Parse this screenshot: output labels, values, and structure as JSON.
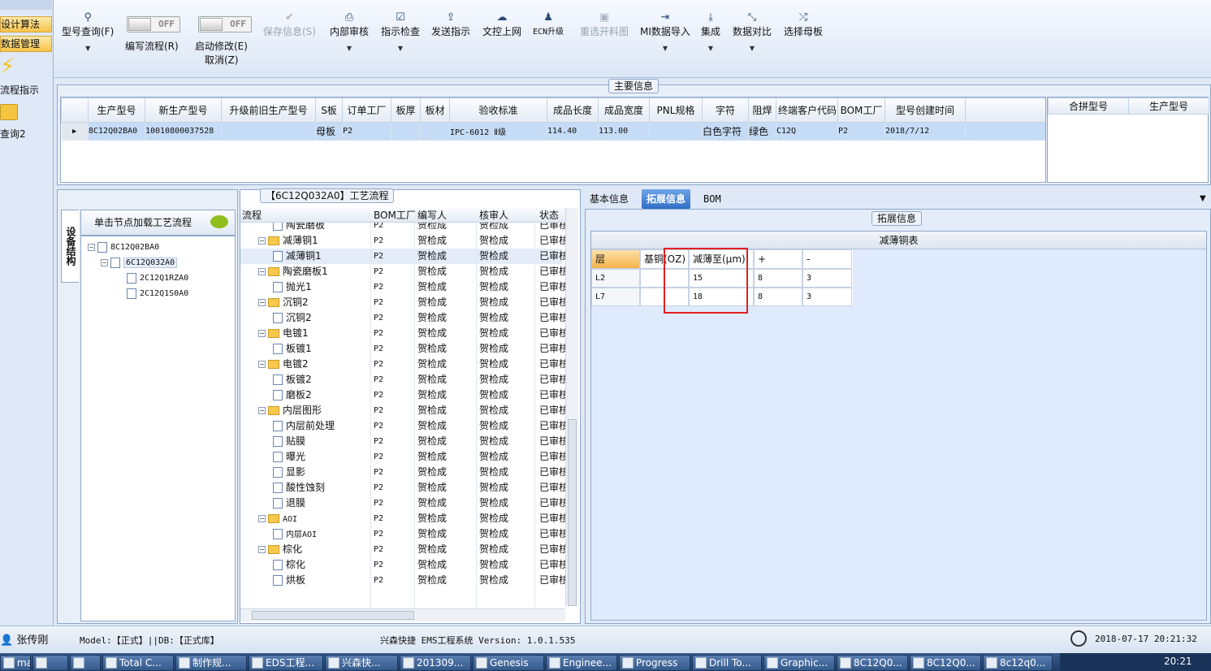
{
  "leftnav": {
    "items": [
      "设计算法",
      "数据管理"
    ],
    "big1": "流程指示",
    "big2": "查询2"
  },
  "toolbar": {
    "buttons": [
      {
        "label": "型号查询(F)",
        "icon": "search-icon"
      },
      {
        "label": "保存信息(S)",
        "icon": "check-icon",
        "disabled": true
      },
      {
        "label": "内部审核",
        "icon": "printer-icon"
      },
      {
        "label": "指示检查",
        "icon": "check-box-icon"
      },
      {
        "label": "发送指示",
        "icon": "upload-icon"
      },
      {
        "label": "文控上网",
        "icon": "cloud-icon"
      },
      {
        "label": "ECN升级",
        "icon": "users-icon"
      },
      {
        "label": "重选开料图",
        "icon": "image-icon",
        "disabled": true
      },
      {
        "label": "MI数据导入",
        "icon": "import-icon"
      },
      {
        "label": "集成",
        "icon": "download-icon"
      },
      {
        "label": "数据对比",
        "icon": "compare-icon"
      },
      {
        "label": "选择母板",
        "icon": "shuffle-icon"
      }
    ],
    "toggle1": {
      "state": "OFF",
      "label": "编写流程(R)"
    },
    "toggle2": {
      "state": "OFF",
      "label": "启动修改(E)",
      "sub": "取消(Z)"
    }
  },
  "main": {
    "title": "主要信息",
    "columns": [
      "生产型号",
      "新生产型号",
      "升级前旧生产型号",
      "S板",
      "订单工厂",
      "板厚",
      "板材",
      "验收标准",
      "成品长度",
      "成品宽度",
      "PNL规格",
      "字符",
      "阻焊",
      "终端客户代码",
      "BOM工厂",
      "型号创建时间"
    ],
    "row": [
      "8C12Q02BA0",
      "10010800037528",
      "",
      "母板",
      "P2",
      "",
      "",
      "IPC-6012 Ⅱ级",
      "114.40",
      "113.00",
      "",
      "白色字符",
      "绿色",
      "C12Q",
      "P2",
      "2018/7/12"
    ],
    "side_columns": [
      "合拼型号",
      "生产型号"
    ]
  },
  "tree": {
    "sidetab": "设备结构",
    "hint": "单击节点加载工艺流程",
    "nodes": [
      "8C12Q02BA0",
      "6C12Q032A0",
      "2C12Q1RZA0",
      "2C12Q1S0A0"
    ]
  },
  "process": {
    "title": "【6C12Q032A0】工艺流程",
    "columns": [
      "流程",
      "BOM工厂",
      "编写人",
      "核审人",
      "状态"
    ],
    "rows": [
      {
        "name": "陶瓷磨板",
        "level": 2,
        "f": "P2",
        "w": "贺检成",
        "c": "贺检成",
        "s": "已审核"
      },
      {
        "name": "减薄铜1",
        "level": 1,
        "f": "P2",
        "w": "贺检成",
        "c": "贺检成",
        "s": "已审核"
      },
      {
        "name": "减薄铜1",
        "level": 2,
        "f": "P2",
        "w": "贺检成",
        "c": "贺检成",
        "s": "已审核",
        "sel": true
      },
      {
        "name": "陶瓷磨板1",
        "level": 1,
        "f": "P2",
        "w": "贺检成",
        "c": "贺检成",
        "s": "已审核"
      },
      {
        "name": "抛光1",
        "level": 2,
        "f": "P2",
        "w": "贺检成",
        "c": "贺检成",
        "s": "已审核"
      },
      {
        "name": "沉铜2",
        "level": 1,
        "f": "P2",
        "w": "贺检成",
        "c": "贺检成",
        "s": "已审核"
      },
      {
        "name": "沉铜2",
        "level": 2,
        "f": "P2",
        "w": "贺检成",
        "c": "贺检成",
        "s": "已审核"
      },
      {
        "name": "电镀1",
        "level": 1,
        "f": "P2",
        "w": "贺检成",
        "c": "贺检成",
        "s": "已审核"
      },
      {
        "name": "板镀1",
        "level": 2,
        "f": "P2",
        "w": "贺检成",
        "c": "贺检成",
        "s": "已审核"
      },
      {
        "name": "电镀2",
        "level": 1,
        "f": "P2",
        "w": "贺检成",
        "c": "贺检成",
        "s": "已审核"
      },
      {
        "name": "板镀2",
        "level": 2,
        "f": "P2",
        "w": "贺检成",
        "c": "贺检成",
        "s": "已审核"
      },
      {
        "name": "磨板2",
        "level": 2,
        "f": "P2",
        "w": "贺检成",
        "c": "贺检成",
        "s": "已审核"
      },
      {
        "name": "内层图形",
        "level": 1,
        "f": "P2",
        "w": "贺检成",
        "c": "贺检成",
        "s": "已审核"
      },
      {
        "name": "内层前处理",
        "level": 2,
        "f": "P2",
        "w": "贺检成",
        "c": "贺检成",
        "s": "已审核"
      },
      {
        "name": "贴膜",
        "level": 2,
        "f": "P2",
        "w": "贺检成",
        "c": "贺检成",
        "s": "已审核"
      },
      {
        "name": "曝光",
        "level": 2,
        "f": "P2",
        "w": "贺检成",
        "c": "贺检成",
        "s": "已审核"
      },
      {
        "name": "显影",
        "level": 2,
        "f": "P2",
        "w": "贺检成",
        "c": "贺检成",
        "s": "已审核"
      },
      {
        "name": "酸性蚀刻",
        "level": 2,
        "f": "P2",
        "w": "贺检成",
        "c": "贺检成",
        "s": "已审核"
      },
      {
        "name": "退膜",
        "level": 2,
        "f": "P2",
        "w": "贺检成",
        "c": "贺检成",
        "s": "已审核"
      },
      {
        "name": "AOI",
        "level": 1,
        "f": "P2",
        "w": "贺检成",
        "c": "贺检成",
        "s": "已审核"
      },
      {
        "name": "内层AOI",
        "level": 2,
        "f": "P2",
        "w": "贺检成",
        "c": "贺检成",
        "s": "已审核"
      },
      {
        "name": "棕化",
        "level": 1,
        "f": "P2",
        "w": "贺检成",
        "c": "贺检成",
        "s": "已审核"
      },
      {
        "name": "棕化",
        "level": 2,
        "f": "P2",
        "w": "贺检成",
        "c": "贺检成",
        "s": "已审核"
      },
      {
        "name": "烘板",
        "level": 2,
        "f": "P2",
        "w": "贺检成",
        "c": "贺检成",
        "s": "已审核"
      }
    ]
  },
  "ext": {
    "tabs": [
      "基本信息",
      "拓展信息",
      "BOM"
    ],
    "active_tab": 1,
    "group": "拓展信息",
    "table_title": "减薄铜表",
    "columns": [
      "层",
      "基铜(OZ)",
      "减薄至(μm)",
      "+",
      "-"
    ],
    "rows": [
      [
        "L2",
        "",
        "15",
        "8",
        "3"
      ],
      [
        "L7",
        "",
        "18",
        "8",
        "3"
      ]
    ]
  },
  "status": {
    "user": "张传刚",
    "model": "Model:【正式】||DB:【正式库】",
    "app": "兴森快捷 EMS工程系统 Version: 1.0.1.535",
    "datetime": "2018-07-17 20:21:32"
  },
  "taskbar": {
    "items": [
      "mail",
      "",
      "",
      "Total C...",
      "制作规...",
      "EDS工程...",
      "兴森快...",
      "201309...",
      "Genesis",
      "Enginee...",
      "Progress",
      "Drill To...",
      "Graphic...",
      "8C12Q0...",
      "8C12Q0...",
      "8c12q0..."
    ],
    "clock": "20:21"
  }
}
